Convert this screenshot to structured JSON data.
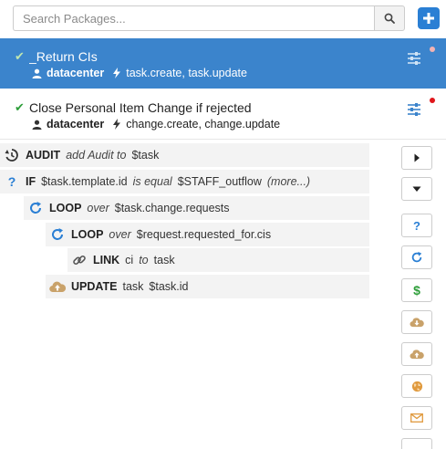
{
  "search": {
    "placeholder": "Search Packages..."
  },
  "packages": [
    {
      "title": "_Return CIs",
      "owner": "datacenter",
      "events": "task.create, task.update",
      "selected": true
    },
    {
      "title": "Close Personal Item Change if rejected",
      "owner": "datacenter",
      "events": "change.create, change.update",
      "selected": false
    }
  ],
  "tree": [
    {
      "kw": "AUDIT",
      "em": "add Audit to",
      "val": "$task"
    },
    {
      "kw": "IF",
      "val1": "$task.template.id",
      "em": "is equal",
      "val2": "$STAFF_outflow",
      "more": "(more...)"
    },
    {
      "kw": "LOOP",
      "em": "over",
      "val": "$task.change.requests"
    },
    {
      "kw": "LOOP",
      "em": "over",
      "val": "$request.requested_for.cis"
    },
    {
      "kw": "LINK",
      "val1": "ci",
      "em": "to",
      "val2": "task"
    },
    {
      "kw": "UPDATE",
      "val1": "task",
      "val2": "$task.id"
    }
  ],
  "colors": {
    "accent": "#3b84cc",
    "blue": "#2a7fd4",
    "green": "#2e9e3a",
    "tan": "#c9a26a",
    "orange": "#e09a3e"
  },
  "icons": [
    "search-icon",
    "plus-icon",
    "check-icon",
    "user-icon",
    "bolt-icon",
    "sliders-icon",
    "history-icon",
    "question-icon",
    "refresh-icon",
    "link-icon",
    "cloud-upload-icon",
    "caret-right-icon",
    "caret-down-icon",
    "dollar-icon",
    "cloud-download-icon",
    "globe-icon",
    "envelope-icon"
  ]
}
